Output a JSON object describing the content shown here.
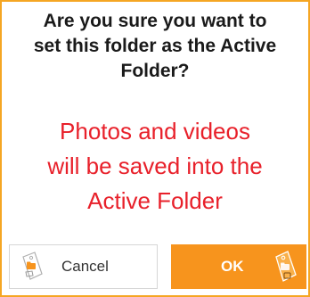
{
  "dialog": {
    "question_lines": [
      "Are you sure you want to",
      "set this folder as the Active",
      "Folder?"
    ],
    "warning_lines": [
      "Photos and videos",
      "will be saved into the",
      "Active Folder"
    ]
  },
  "buttons": {
    "cancel_label": "Cancel",
    "ok_label": "OK",
    "cancel_icon": "folder-tag-icon",
    "ok_icon": "folder-tag-icon"
  },
  "colors": {
    "accent": "#f7941d",
    "border": "#f5a623",
    "warning_text": "#e8202a"
  }
}
